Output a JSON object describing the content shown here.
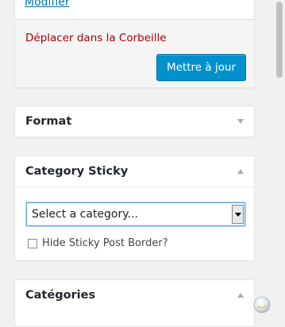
{
  "publish": {
    "modify_label": "Modifier",
    "trash_label": "Déplacer dans la Corbeille",
    "update_label": "Mettre à jour"
  },
  "format": {
    "title": "Format",
    "toggle_icon": "triangle-down-icon"
  },
  "category_sticky": {
    "title": "Category Sticky",
    "toggle_icon": "triangle-up-icon",
    "select_value": "Select a category...",
    "checkbox_label": "Hide Sticky Post Border?",
    "checkbox_checked": false
  },
  "categories": {
    "title": "Catégories",
    "toggle_icon": "triangle-up-icon"
  },
  "colors": {
    "accent": "#0091cd",
    "link": "#0073aa",
    "danger": "#a00000"
  }
}
